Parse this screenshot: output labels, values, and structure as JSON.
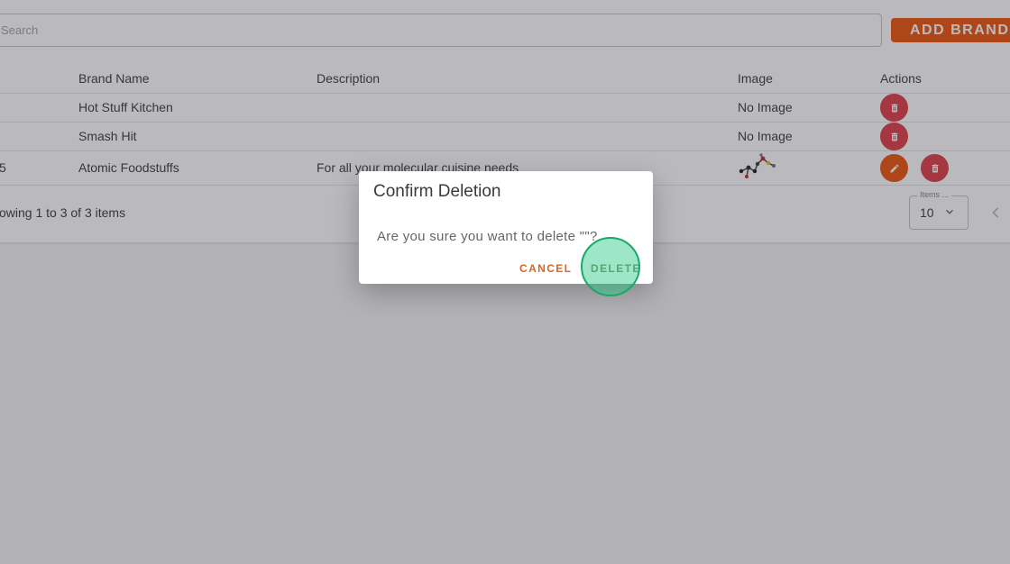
{
  "search": {
    "placeholder": "Search"
  },
  "toolbar": {
    "add_label": "ADD BRAND"
  },
  "table": {
    "headers": {
      "name": "Brand Name",
      "description": "Description",
      "image": "Image",
      "actions": "Actions"
    },
    "rows": [
      {
        "id_fragment": "",
        "name": "Hot Stuff Kitchen",
        "description": "",
        "image": "No Image"
      },
      {
        "id_fragment": "",
        "name": "Smash Hit",
        "description": "",
        "image": "No Image"
      },
      {
        "id_fragment": "5",
        "name": "Atomic Foodstuffs",
        "description": "For all your molecular cuisine needs",
        "image": ""
      }
    ]
  },
  "footer": {
    "showing": "owing 1 to 3 of 3 items",
    "items_legend": "Items ...",
    "items_value": "10"
  },
  "dialog": {
    "title": "Confirm Deletion",
    "message": "Are you sure you want to delete \"\"?",
    "cancel_label": "CANCEL",
    "delete_label": "DELETE"
  },
  "colors": {
    "accent": "#ec5b14",
    "danger": "#e0454d",
    "click_marker": "#1aa86b"
  },
  "icons": {
    "delete": "trash-icon",
    "edit": "pencil-icon",
    "chevron": "chevron-down-icon",
    "prev": "chevron-left-icon"
  }
}
